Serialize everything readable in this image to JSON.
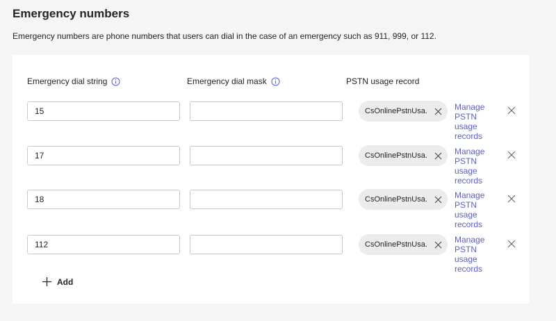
{
  "section": {
    "title": "Emergency numbers",
    "description": "Emergency numbers are phone numbers that users can dial in the case of an emergency such as 911, 999, or 112."
  },
  "columns": {
    "dial_string": "Emergency dial string",
    "dial_mask": "Emergency dial mask",
    "pstn_usage": "PSTN usage record"
  },
  "rows": [
    {
      "dial_string": "15",
      "dial_mask": "",
      "pstn_usage": "CsOnlinePstnUsa...",
      "manage_link": "Manage PSTN usage records"
    },
    {
      "dial_string": "17",
      "dial_mask": "",
      "pstn_usage": "CsOnlinePstnUsa...",
      "manage_link": "Manage PSTN usage records"
    },
    {
      "dial_string": "18",
      "dial_mask": "",
      "pstn_usage": "CsOnlinePstnUsa...",
      "manage_link": "Manage PSTN usage records"
    },
    {
      "dial_string": "112",
      "dial_mask": "",
      "pstn_usage": "CsOnlinePstnUsa...",
      "manage_link": "Manage PSTN usage records"
    }
  ],
  "add_label": "Add",
  "icons": {
    "info": "info-icon",
    "remove": "close-icon",
    "add": "plus-icon"
  },
  "colors": {
    "link": "#5b5fc7",
    "chip_bg": "#ececec",
    "page_bg": "#f5f5f5"
  }
}
